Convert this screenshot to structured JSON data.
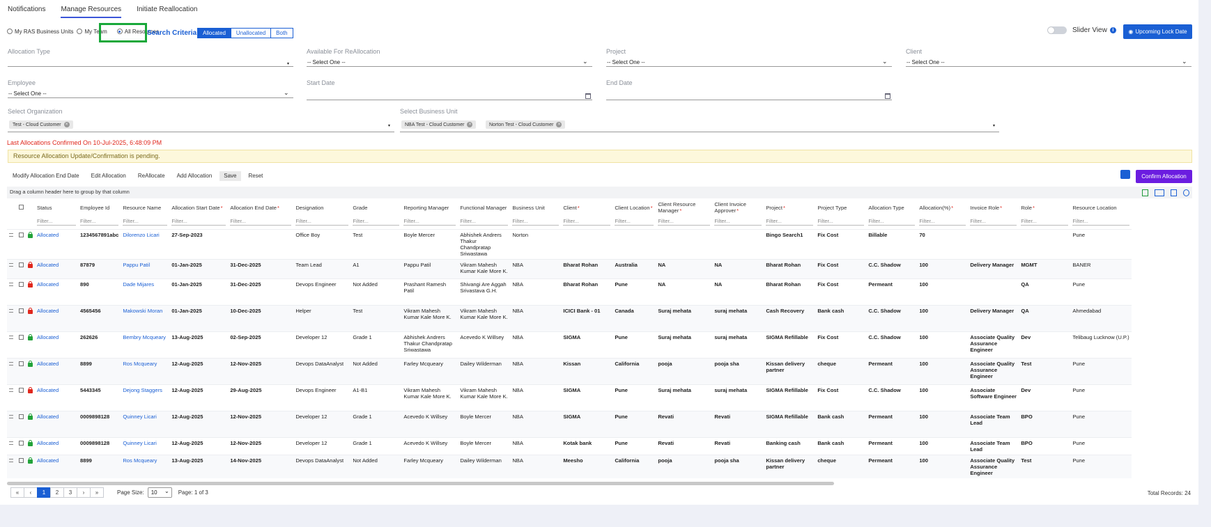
{
  "tabs": [
    "Notifications",
    "Manage Resources",
    "Initiate Reallocation"
  ],
  "scope": {
    "options": [
      "My RAS Business Units",
      "My Team",
      "All Resources"
    ],
    "selected": "All Resources",
    "search_criteria": "Search Criteria",
    "segments": [
      "Allocated",
      "Unallocated",
      "Both"
    ],
    "segment_selected": "Allocated"
  },
  "header": {
    "slider_view": "Slider View",
    "lock_button": "Upcoming Lock Date"
  },
  "filters": {
    "allocation_type": {
      "label": "Allocation Type",
      "value": ""
    },
    "available": {
      "label": "Available For ReAllocation",
      "value": "-- Select One --"
    },
    "project": {
      "label": "Project",
      "value": "-- Select One --"
    },
    "client": {
      "label": "Client",
      "value": "-- Select One --"
    },
    "employee": {
      "label": "Employee",
      "value": "-- Select One --"
    },
    "start_date": {
      "label": "Start Date",
      "value": ""
    },
    "end_date": {
      "label": "End Date",
      "value": ""
    },
    "organization": {
      "label": "Select Organization",
      "chips": [
        "Test - Cloud Customer"
      ]
    },
    "business_unit": {
      "label": "Select Business Unit",
      "chips": [
        "NBA Test - Cloud Customer",
        "Norton Test - Cloud Customer"
      ]
    }
  },
  "messages": {
    "last_alloc": "Last Allocations Confirmed On 10-Jul-2025, 6:48:09 PM",
    "pending": "Resource Allocation Update/Confirmation is pending."
  },
  "toolbar": {
    "buttons": [
      "Modify Allocation End Date",
      "Edit Allocation",
      "ReAllocate",
      "Add Allocation",
      "Save",
      "Reset"
    ],
    "confirm": "Confirm Allocation"
  },
  "grid": {
    "group_hint": "Drag a column header here to group by that column",
    "filter_placeholder": "Filter...",
    "columns": [
      {
        "label": "Status",
        "req": false
      },
      {
        "label": "Employee Id",
        "req": false
      },
      {
        "label": "Resource Name",
        "req": false
      },
      {
        "label": "Allocation Start Date",
        "req": true
      },
      {
        "label": "Allocation End Date",
        "req": true
      },
      {
        "label": "Designation",
        "req": false
      },
      {
        "label": "Grade",
        "req": false
      },
      {
        "label": "Reporting Manager",
        "req": false
      },
      {
        "label": "Functional Manager",
        "req": false
      },
      {
        "label": "Business Unit",
        "req": false
      },
      {
        "label": "Client",
        "req": true
      },
      {
        "label": "Client Location",
        "req": true
      },
      {
        "label": "Client Resource Manager",
        "req": true
      },
      {
        "label": "Client Invoice Approver",
        "req": true
      },
      {
        "label": "Project",
        "req": true
      },
      {
        "label": "Project Type",
        "req": false
      },
      {
        "label": "Allocation Type",
        "req": false
      },
      {
        "label": "Allocation(%)",
        "req": true
      },
      {
        "label": "Invoice Role",
        "req": true
      },
      {
        "label": "Role",
        "req": true
      },
      {
        "label": "Resource Location",
        "req": false
      }
    ],
    "rows": [
      {
        "lock": "green",
        "h": 38,
        "c": [
          "Allocated",
          "1234567891abc",
          "Dilorenzo Licari",
          "27-Sep-2023",
          "",
          "Office Boy",
          "Test",
          "Boyle Mercer",
          "Abhishek Andrers Thakur Chandpratap Sriwastawa",
          "Norton",
          "",
          "",
          "",
          "",
          "Bingo Search1",
          "Fix Cost",
          "Billable",
          "70",
          "",
          "",
          "Pune"
        ]
      },
      {
        "lock": "red",
        "h": 28,
        "c": [
          "Allocated",
          "87879",
          "Pappu Patil",
          "01-Jan-2025",
          "31-Dec-2025",
          "Team Lead",
          "A1",
          "Pappu Patil",
          "Vikram Mahesh Kumar Kale More K.",
          "NBA",
          "Bharat Rohan",
          "Australia",
          "NA",
          "NA",
          "Bharat Rohan",
          "Fix Cost",
          "C.C. Shadow",
          "100",
          "Delivery Manager",
          "MGMT",
          "BANER"
        ]
      },
      {
        "lock": "red",
        "h": 38,
        "c": [
          "Allocated",
          "890",
          "Dade Mijares",
          "01-Jan-2025",
          "31-Dec-2025",
          "Devops Engineer",
          "Not Added",
          "Prashant Ramesh Patil",
          "Shivangi Are Aggah Srivastava G.H.",
          "NBA",
          "Bharat Rohan",
          "Pune",
          "NA",
          "NA",
          "Bharat Rohan",
          "Fix Cost",
          "Permeant",
          "100",
          "",
          "QA",
          "Pune"
        ]
      },
      {
        "lock": "red",
        "h": 38,
        "c": [
          "Allocated",
          "4565456",
          "Makowski Moran",
          "01-Jan-2025",
          "10-Dec-2025",
          "Helper",
          "Test",
          "Vikram Mahesh Kumar Kale More K.",
          "Vikram Mahesh Kumar Kale More K.",
          "NBA",
          "ICICI Bank - 01",
          "Canada",
          "Suraj mehata",
          "suraj mehata",
          "Cash Recovery",
          "Bank cash",
          "C.C. Shadow",
          "100",
          "Delivery Manager",
          "QA",
          "Ahmedabad"
        ]
      },
      {
        "lock": "green",
        "h": 38,
        "c": [
          "Allocated",
          "262626",
          "Bembry Mcqueary",
          "13-Aug-2025",
          "02-Sep-2025",
          "Developer 12",
          "Grade 1",
          "Abhishek Andrers Thakur Chandpratap Sriwastawa",
          "Acevedo K Willsey",
          "NBA",
          "SIGMA",
          "Pune",
          "Suraj mehata",
          "suraj mehata",
          "SIGMA Refillable",
          "Fix Cost",
          "C.C. Shadow",
          "100",
          "Associate Quality Assurance Engineer",
          "Dev",
          "Telibaug Lucknow (U.P.)"
        ]
      },
      {
        "lock": "green",
        "h": 38,
        "c": [
          "Allocated",
          "8899",
          "Ros Mcqueary",
          "12-Aug-2025",
          "12-Nov-2025",
          "Devops DataAnalyst",
          "Not Added",
          "Farley Mcqueary",
          "Dailey Wilderman",
          "NBA",
          "Kissan",
          "California",
          "pooja",
          "pooja sha",
          "Kissan delivery partner",
          "cheque",
          "Permeant",
          "100",
          "Associate Quality Assurance Engineer",
          "Test",
          "Pune"
        ]
      },
      {
        "lock": "red",
        "h": 38,
        "c": [
          "Allocated",
          "5443345",
          "Dejong Staggers",
          "12-Aug-2025",
          "29-Aug-2025",
          "Devops Engineer",
          "A1-B1",
          "Vikram Mahesh Kumar Kale More K.",
          "Vikram Mahesh Kumar Kale More K.",
          "NBA",
          "SIGMA",
          "Pune",
          "Suraj mehata",
          "suraj mehata",
          "SIGMA Refillable",
          "Fix Cost",
          "C.C. Shadow",
          "100",
          "Associate Software Engineer",
          "Dev",
          "Pune"
        ]
      },
      {
        "lock": "green",
        "h": 38,
        "c": [
          "Allocated",
          "0009898128",
          "Quinney Licari",
          "12-Aug-2025",
          "12-Nov-2025",
          "Developer 12",
          "Grade 1",
          "Acevedo K Willsey",
          "Boyle Mercer",
          "NBA",
          "SIGMA",
          "Pune",
          "Revati",
          "Revati",
          "SIGMA Refillable",
          "Bank cash",
          "Permeant",
          "100",
          "Associate Team Lead",
          "BPO",
          "Pune"
        ]
      },
      {
        "lock": "green",
        "h": 19,
        "c": [
          "Allocated",
          "0009898128",
          "Quinney Licari",
          "12-Aug-2025",
          "12-Nov-2025",
          "Developer 12",
          "Grade 1",
          "Acevedo K Willsey",
          "Boyle Mercer",
          "NBA",
          "Kotak bank",
          "Pune",
          "Revati",
          "Revati",
          "Banking cash",
          "Bank cash",
          "Permeant",
          "100",
          "Associate Team Lead",
          "BPO",
          "Pune"
        ]
      },
      {
        "lock": "green",
        "h": 34,
        "c": [
          "Allocated",
          "8899",
          "Ros Mcqueary",
          "13-Aug-2025",
          "14-Nov-2025",
          "Devops DataAnalyst",
          "Not Added",
          "Farley Mcqueary",
          "Dailey Wilderman",
          "NBA",
          "Meesho",
          "California",
          "pooja",
          "pooja sha",
          "Kissan delivery partner",
          "cheque",
          "Permeant",
          "100",
          "Associate Quality Assurance Engineer",
          "Test",
          "Pune"
        ]
      }
    ]
  },
  "pager": {
    "pages": [
      "«",
      "‹",
      "1",
      "2",
      "3",
      "›",
      "»"
    ],
    "current": "1",
    "page_size_label": "Page Size:",
    "page_size": "10",
    "page_of": "Page: 1 of 3",
    "total": "Total Records: 24"
  }
}
